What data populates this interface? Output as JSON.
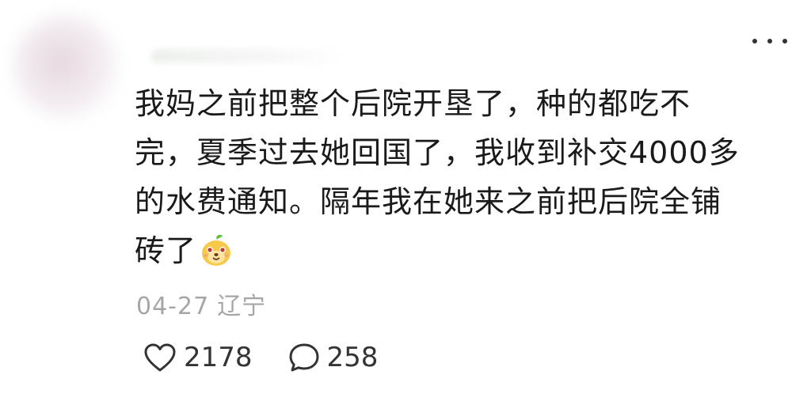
{
  "comment": {
    "lines": [
      "我妈之前把整个后院开垦了，种的都吃不",
      "完，夏季过去她回国了，我收到补交4000多",
      "的水费通知。隔年我在她来之前把后院全铺",
      "砖了"
    ],
    "emoji": "yellow-smiling-emoji-icon"
  },
  "meta": {
    "date": "04-27",
    "region": "辽宁"
  },
  "actions": {
    "likes": "2178",
    "comments": "258"
  },
  "icons": {
    "more": "more-dots-icon",
    "like": "heart-outline-icon",
    "comment": "speech-bubble-icon"
  },
  "colors": {
    "text": "#1a1a1a",
    "meta": "#a6a6a6",
    "icon": "#333333"
  }
}
